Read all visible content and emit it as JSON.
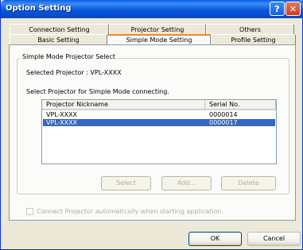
{
  "window": {
    "title": "Option Setting"
  },
  "title_buttons": {
    "help": "?",
    "close": "✕"
  },
  "tabs": {
    "back_row": [
      "Connection Setting",
      "Projector Setting",
      "Others"
    ],
    "front_row": [
      "Basic Setting",
      "Simple Mode Setting",
      "Profile Setting"
    ],
    "active": "Simple Mode Setting"
  },
  "group": {
    "legend": "Simple Mode Projector Select",
    "selected_label": "Selected Projector : VPL-XXXX",
    "instruction": "Select Projector for Simple Mode connecting."
  },
  "list": {
    "columns": [
      "Projector Nickname",
      "Serial No."
    ],
    "rows": [
      {
        "nickname": "VPL-XXXX",
        "serial": "0000014",
        "selected": false
      },
      {
        "nickname": "VPL-XXXX",
        "serial": "0000017",
        "selected": true
      }
    ]
  },
  "buttons": {
    "select": "Select",
    "add": "Add...",
    "delete": "Delete",
    "ok": "OK",
    "cancel": "Cancel"
  },
  "auto_connect": {
    "label": "Connect Projector automatically when starting application",
    "checked": false
  },
  "colors": {
    "title_bar": "#0a58db",
    "selection": "#316ac5",
    "active_tab_accent": "#e68b2c"
  }
}
